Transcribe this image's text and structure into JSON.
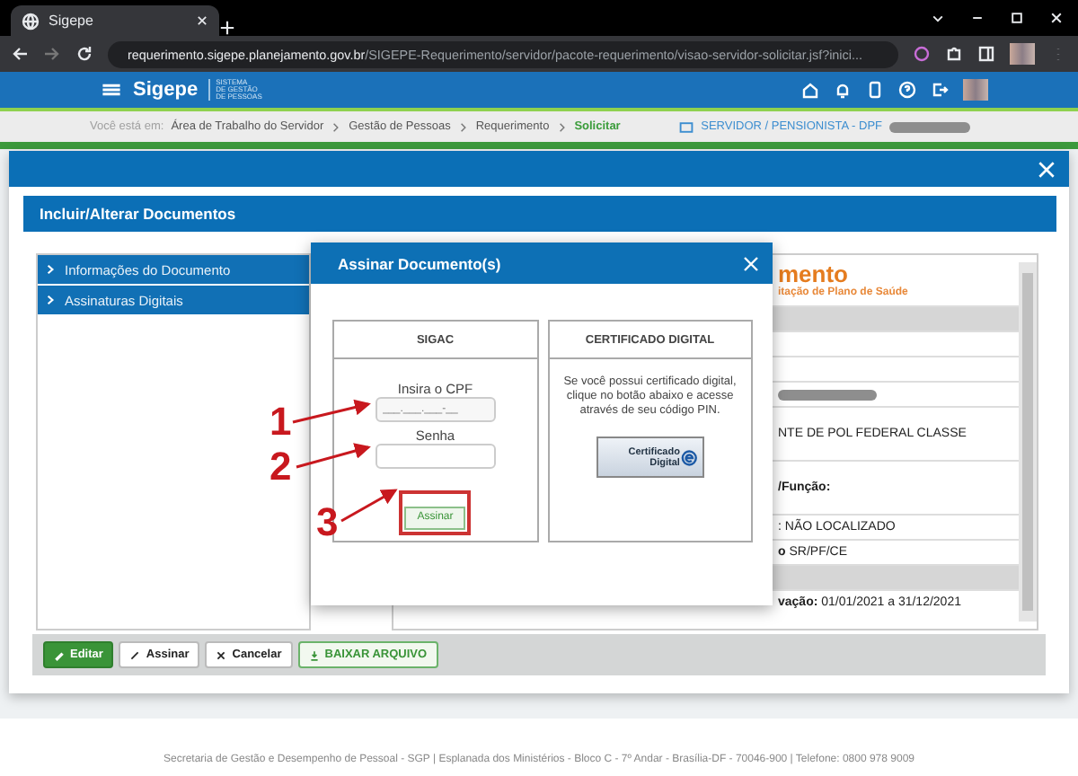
{
  "browser": {
    "tab_title": "Sigepe",
    "url_host": "requerimento.sigepe.planejamento.gov.br",
    "url_path": "/SIGEPE-Requerimento/servidor/pacote-requerimento/visao-servidor-solicitar.jsf?inici..."
  },
  "header": {
    "brand": "Sigepe",
    "brand_sub": [
      "SISTEMA",
      "DE GESTÃO",
      "DE PESSOAS"
    ]
  },
  "breadcrumb": {
    "label": "Você está em:",
    "items": [
      {
        "text": "Área de Trabalho do Servidor",
        "selected": false
      },
      {
        "text": "Gestão de Pessoas",
        "selected": false
      },
      {
        "text": "Requerimento",
        "selected": false
      },
      {
        "text": "Solicitar",
        "selected": true
      }
    ],
    "profile": "SERVIDOR / PENSIONISTA - DPF"
  },
  "panel": {
    "title": "Incluir/Alterar Documentos"
  },
  "accordion": [
    {
      "label": "Informações do Documento",
      "expanded": false
    },
    {
      "label": "Assinaturas Digitais",
      "expanded": false
    }
  ],
  "document": {
    "heading": "mento",
    "subtitle": "itação de Plano de Saúde",
    "rows": [
      {
        "kind": "shaded"
      },
      {
        "kind": "blank"
      },
      {
        "kind": "blank"
      },
      {
        "kind": "redacted"
      },
      {
        "kind": "tall",
        "text": "NTE DE POL FEDERAL CLASSE"
      },
      {
        "kind": "label",
        "text": "/Função:"
      },
      {
        "kind": "text",
        "text": ": NÃO LOCALIZADO"
      },
      {
        "kind": "text",
        "text": "**o** SR/PF/CE"
      },
      {
        "kind": "shaded"
      },
      {
        "kind": "text",
        "text": "**vação:** 01/01/2021 a 31/12/2021"
      }
    ]
  },
  "sign_dialog": {
    "title": "Assinar Documento(s)",
    "sigac": {
      "heading": "SIGAC",
      "cpf_label": "Insira o CPF",
      "cpf_placeholder": "___.___.___-__",
      "password_label": "Senha",
      "button": "Assinar"
    },
    "certificate": {
      "heading": "CERTIFICADO DIGITAL",
      "text": "Se você possui certificado digital, clique no botão abaixo e acesse através de seu código PIN.",
      "button": "Certificado Digital"
    }
  },
  "annotations": [
    {
      "number": "1"
    },
    {
      "number": "2"
    },
    {
      "number": "3"
    }
  ],
  "actions": [
    {
      "label": "Editar",
      "kind": "primary"
    },
    {
      "label": "Assinar",
      "kind": "default"
    },
    {
      "label": "Cancelar",
      "kind": "default"
    },
    {
      "label": "BAIXAR ARQUIVO",
      "kind": "outline"
    }
  ],
  "footer": "Secretaria de Gestão e Desempenho de Pessoal - SGP | Esplanada dos Ministérios - Bloco C - 7º Andar - Brasília-DF - 70046-900 | Telefone: 0800 978 9009"
}
